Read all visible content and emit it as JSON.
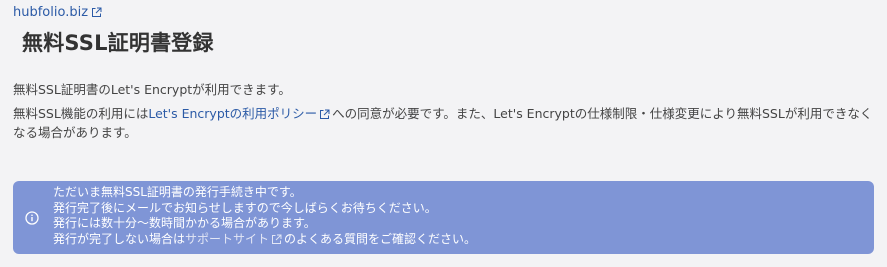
{
  "header": {
    "domain": "hubfolio.biz",
    "title": "無料SSL証明書登録"
  },
  "description": {
    "line1": "無料SSL証明書のLet's Encryptが利用できます。",
    "line2_pre": "無料SSL機能の利用には",
    "line2_link": "Let's Encryptの利用ポリシー",
    "line2_post": "への同意が必要です。また、Let's Encryptの仕様制限・仕様変更により無料SSLが利用できなくなる場合があります。"
  },
  "notice": {
    "line1": "ただいま無料SSL証明書の発行手続き中です。",
    "line2": "発行完了後にメールでお知らせしますので今しばらくお待ちください。",
    "line3": "発行には数十分〜数時間かかる場合があります。",
    "line4_pre": "発行が完了しない場合は",
    "line4_link": "サポートサイト",
    "line4_post": "のよくある質問をご確認ください。"
  },
  "colors": {
    "notice_bg": "#7f95d6",
    "link": "#2b5aa6",
    "background": "#f3f3f5"
  },
  "icons": {
    "external_link": "external-link-icon",
    "info": "info-icon"
  }
}
